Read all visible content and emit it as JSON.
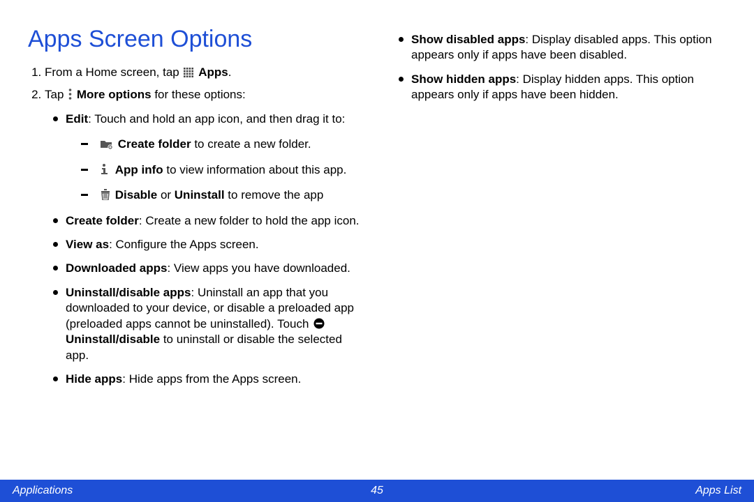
{
  "title": "Apps Screen Options",
  "step1_pre": "From a Home screen, tap ",
  "step1_bold": "Apps",
  "step1_post": ".",
  "step2_pre": "Tap ",
  "step2_bold": "More options",
  "step2_post": " for these options:",
  "edit_b": "Edit",
  "edit_txt": ": Touch and hold an app icon, and then drag it to:",
  "cf_b": "Create folder",
  "cf_txt": " to create a new folder.",
  "ai_b": "App info",
  "ai_txt": " to view information about this app.",
  "du_b1": "Disable",
  "du_mid": " or ",
  "du_b2": "Uninstall",
  "du_txt": " to remove the app",
  "cfolder_b": "Create folder",
  "cfolder_txt": ": Create a new folder to hold the app icon.",
  "va_b": "View as",
  "va_txt": ": Configure the Apps screen.",
  "dl_b": "Downloaded apps",
  "dl_txt": ": View apps you have downloaded.",
  "ud_b": "Uninstall/disable apps",
  "ud_txt1": ": Uninstall an app that you downloaded to your device, or disable a preloaded app (preloaded apps cannot be uninstalled). Touch ",
  "ud_b2": "Uninstall/disable",
  "ud_txt2": " to uninstall or disable the selected app.",
  "hide_b": "Hide apps",
  "hide_txt": ": Hide apps from the Apps screen.",
  "sd_b": "Show disabled apps",
  "sd_txt": ": Display disabled apps. This option appears only if apps have been disabled.",
  "sh_b": "Show hidden apps",
  "sh_txt": ": Display hidden apps. This option appears only if apps have been hidden.",
  "footer": {
    "left": "Applications",
    "center": "45",
    "right": "Apps List"
  }
}
